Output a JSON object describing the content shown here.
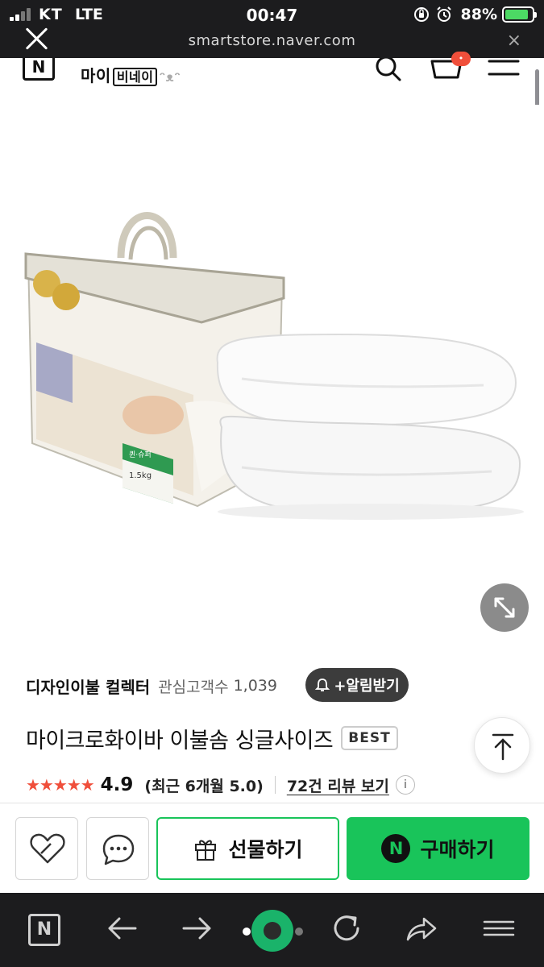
{
  "status_bar": {
    "carrier": "KT",
    "network": "LTE",
    "time": "00:47",
    "battery_percent": "88%",
    "battery_level": 0.88,
    "icons": [
      "signal-icon",
      "orientation-lock-icon",
      "alarm-icon",
      "battery-charging-icon"
    ]
  },
  "browser": {
    "url": "smartstore.naver.com",
    "close_icon": "close-icon",
    "clear_icon": "×"
  },
  "store_header": {
    "logo": "N",
    "brand_prefix": "마이",
    "brand_boxed": "비네이",
    "brand_suffix": "ᵔᴥᵔ",
    "icons": [
      "search-icon",
      "cart-icon",
      "menu-icon"
    ]
  },
  "product": {
    "store_name": "디자인이불 컬렉터",
    "favorites_label": "관심고객수",
    "favorites_count": "1,039",
    "alarm_button": "+알림받기",
    "title": "마이크로화이바 이불솜 싱글사이즈",
    "badge": "BEST",
    "stars": "★★★★★",
    "rating": "4.9",
    "recent_rating": "(최근 6개월 5.0)",
    "reviews_link": "72건 리뷰 보기",
    "info_icon": "i",
    "package_label_1": "퀸·슈퍼",
    "package_label_2": "1.5kg"
  },
  "buy_bar": {
    "gift_label": "선물하기",
    "purchase_label": "구매하기",
    "npay_logo": "N",
    "accent": "#19c45a"
  },
  "browser_toolbar": {
    "home_logo": "N",
    "icons": [
      "naver-home-icon",
      "back-arrow-icon",
      "forward-arrow-icon",
      "tabs-indicator-icon",
      "reload-icon",
      "share-icon",
      "menu-icon"
    ]
  }
}
